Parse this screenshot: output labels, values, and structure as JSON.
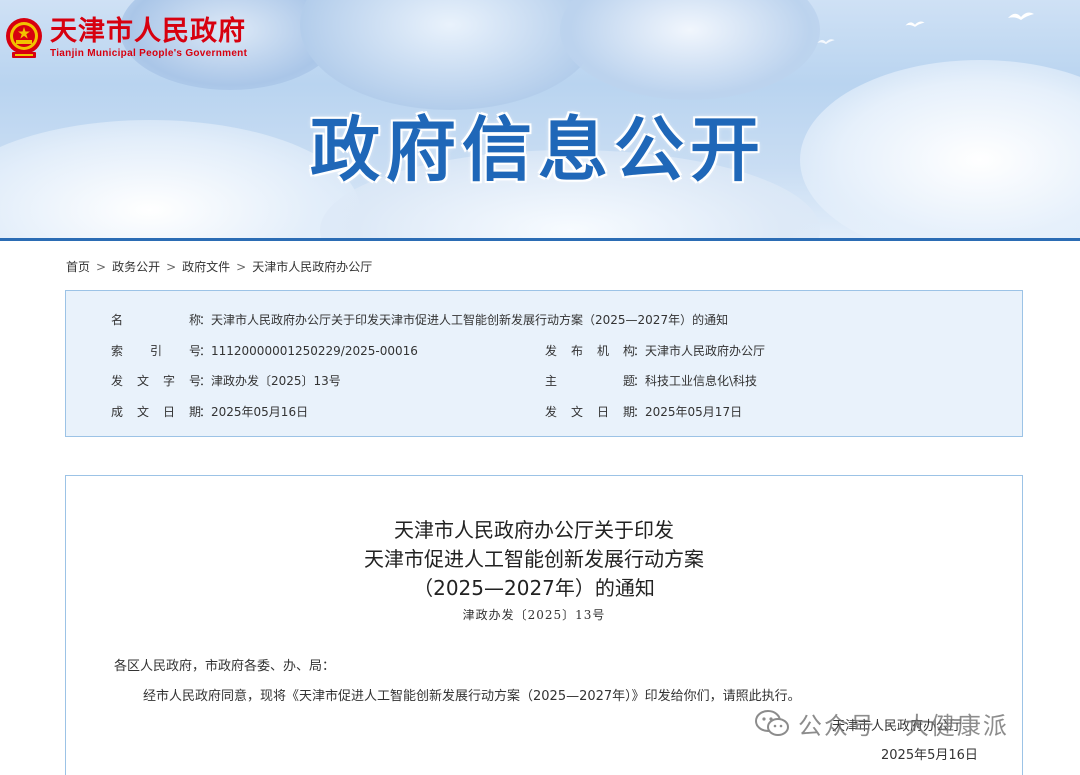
{
  "header": {
    "site_name_cn": "天津市人民政府",
    "site_name_en": "Tianjin Municipal People's Government",
    "banner_title": "政府信息公开"
  },
  "breadcrumb": {
    "items": [
      "首页",
      "政务公开",
      "政府文件",
      "天津市人民政府办公厅"
    ],
    "separator": ">"
  },
  "metadata": {
    "colon": "：",
    "name_label": "名称",
    "name_value": "天津市人民政府办公厅关于印发天津市促进人工智能创新发展行动方案（2025—2027年）的通知",
    "index_label": "索引号",
    "index_value": "11120000001250229/2025-00016",
    "publisher_label": "发布机构",
    "publisher_value": "天津市人民政府办公厅",
    "doc_number_label": "发文字号",
    "doc_number_value": "津政办发〔2025〕13号",
    "subject_label": "主题",
    "subject_value": "科技工业信息化\\科技",
    "created_label": "成文日期",
    "created_value": "2025年05月16日",
    "issued_label": "发文日期",
    "issued_value": "2025年05月17日"
  },
  "document": {
    "title_line1": "天津市人民政府办公厅关于印发",
    "title_line2": "天津市促进人工智能创新发展行动方案",
    "title_line3": "（2025—2027年）的通知",
    "number": "津政办发〔2025〕13号",
    "salutation": "各区人民政府，市政府各委、办、局：",
    "body": "经市人民政府同意，现将《天津市促进人工智能创新发展行动方案（2025—2027年）》印发给你们，请照此执行。",
    "signature": "天津市人民政府办公厅",
    "date": "2025年5月16日"
  },
  "watermark": {
    "text": "公众号 · 大健康派",
    "icon": "wechat-icon"
  },
  "colors": {
    "brand_red": "#d7000f",
    "title_blue": "#1f67b8",
    "box_border": "#9cc3e6",
    "box_bg": "#e9f2fb"
  }
}
